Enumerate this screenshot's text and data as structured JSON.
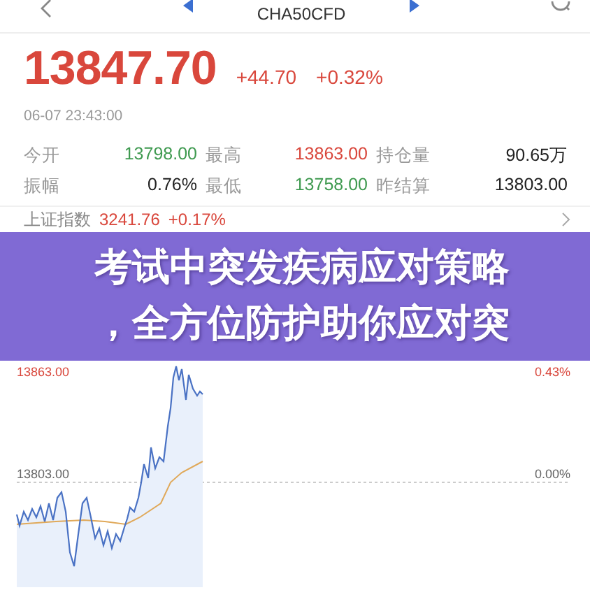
{
  "header": {
    "symbol": "CHA50CFD"
  },
  "quote": {
    "price": "13847.70",
    "change": "+44.70",
    "change_pct": "+0.32%",
    "time": "06-07 23:43:00",
    "color": "#d9473c"
  },
  "stats": [
    {
      "label": "今开",
      "value": "13798.00",
      "color": "#3f9a50"
    },
    {
      "label": "最高",
      "value": "13863.00",
      "color": "#d9473c"
    },
    {
      "label": "持仓量",
      "value": "90.65万",
      "color": "#222222"
    },
    {
      "label": "振幅",
      "value": "0.76%",
      "color": "#222222"
    },
    {
      "label": "最低",
      "value": "13758.00",
      "color": "#3f9a50"
    },
    {
      "label": "昨结算",
      "value": "13803.00",
      "color": "#222222"
    }
  ],
  "indices": [
    {
      "name": "上证指数",
      "value": "3241.76",
      "change": "+0.17%",
      "color": "#d9473c"
    }
  ],
  "chart": {
    "high": "13863.00",
    "high_pct": "0.43%",
    "base": "13803.00",
    "base_pct": "0.00%"
  },
  "banner": {
    "lines": [
      "考试中突发疾病应对策略",
      "，全方位防护助你应对突"
    ]
  }
}
